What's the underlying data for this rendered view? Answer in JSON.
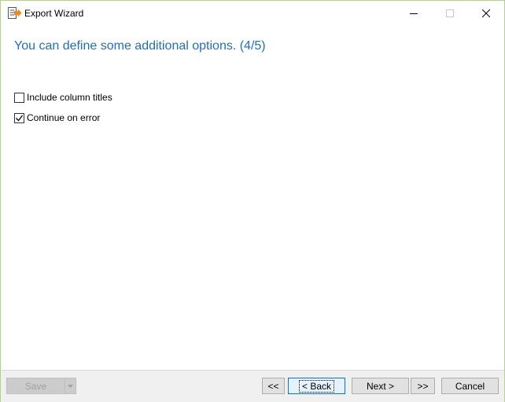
{
  "window": {
    "title": "Export Wizard"
  },
  "page": {
    "heading": "You can define some additional options. (4/5)"
  },
  "options": [
    {
      "label": "Include column titles",
      "checked": false
    },
    {
      "label": "Continue on error",
      "checked": true
    }
  ],
  "footer": {
    "save_label": "Save",
    "first_label": "<<",
    "back_label": "< Back",
    "next_label": "Next >",
    "last_label": ">>",
    "cancel_label": "Cancel"
  },
  "colors": {
    "heading": "#1f6fbf",
    "window_border": "#b4d08a",
    "footer_bg": "#f0f0f0",
    "focus_border": "#0078d7"
  },
  "icons": {
    "app": "export-wizard-icon",
    "minimize": "minimize-icon",
    "maximize": "maximize-icon",
    "close": "close-icon",
    "dropdown": "chevron-down-icon",
    "check": "checkmark-icon"
  }
}
